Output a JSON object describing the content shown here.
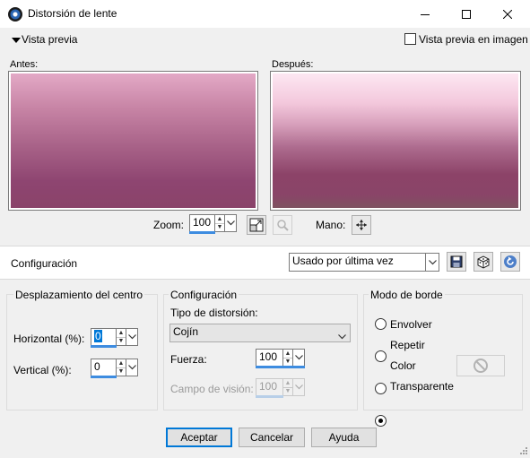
{
  "window": {
    "title": "Distorsión de lente"
  },
  "preview_bar": {
    "toggle_label": "Vista previa",
    "image_preview_label": "Vista previa en imagen",
    "image_preview_checked": false
  },
  "previews": {
    "before_label": "Antes:",
    "after_label": "Después:"
  },
  "zoom": {
    "label": "Zoom:",
    "value": "100",
    "pan_label": "Mano:"
  },
  "configuration_bar": {
    "label": "Configuración",
    "preset_value": "Usado por última vez"
  },
  "center_offset": {
    "title": "Desplazamiento del centro",
    "horizontal_label": "Horizontal (%):",
    "horizontal_value": "0",
    "vertical_label": "Vertical (%):",
    "vertical_value": "0"
  },
  "settings": {
    "title": "Configuración",
    "distortion_type_label": "Tipo de distorsión:",
    "distortion_type_value": "Cojín",
    "strength_label": "Fuerza:",
    "strength_value": "100",
    "field_of_view_label": "Campo de visión:",
    "field_of_view_value": "100"
  },
  "edge_mode": {
    "title": "Modo de borde",
    "options": [
      {
        "label": "Envolver",
        "selected": false
      },
      {
        "label": "Repetir",
        "selected": false
      },
      {
        "label": "Color",
        "selected": false
      },
      {
        "label": "Transparente",
        "selected": true
      }
    ]
  },
  "buttons": {
    "accept": "Aceptar",
    "cancel": "Cancelar",
    "help": "Ayuda"
  },
  "colors": {
    "accent": "#0078d7",
    "spin_underline": "#3d8ce0"
  }
}
